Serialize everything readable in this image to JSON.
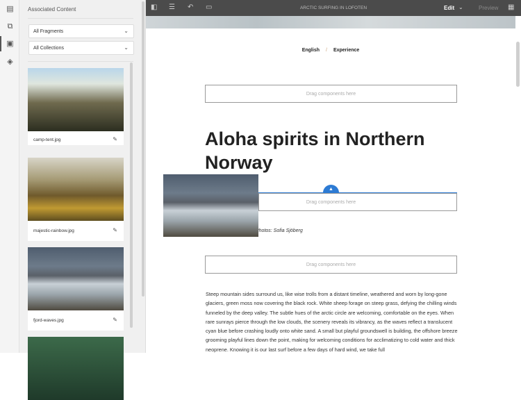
{
  "sidebar": {
    "title": "Associated Content",
    "fragments_select": "All Fragments",
    "collections_select": "All Collections",
    "assets": [
      {
        "name": "camp-tent.jpg"
      },
      {
        "name": "majestic-rainbow.jpg"
      },
      {
        "name": "fjord-waves.jpg"
      },
      {
        "name": ""
      }
    ]
  },
  "toolbar": {
    "title": "ARCTIC SURFING IN LOFOTEN",
    "mode": "Edit",
    "preview": "Preview"
  },
  "page": {
    "breadcrumb": [
      "English",
      "Experience"
    ],
    "breadcrumb_sep": "/",
    "drop_text": "Drag components here",
    "heading": "Aloha spirits in Northern Norway",
    "photo_credit": "Photos: Sofia Sjöberg",
    "body": "Steep mountain sides surround us, like wise trolls from a distant timeline, weathered and worn by long-gone glaciers, green moss now covering the black rock. White sheep forage on steep grass, defying the chilling winds funneled by the deep valley. The subtle hues of the arctic circle are welcoming, comfortable on the eyes. When rare sunrays pierce through the low clouds, the scenery reveals its vibrancy, as the waves reflect a translucent cyan blue before crashing loudly onto white sand. A small but playful groundswell is building, the offshore breeze grooming playful lines down the point, making for welcoming conditions for acclimatizing to cold water and thick neoprene. Knowing it is our last surf before a few days of hard wind, we take full"
  },
  "colors": {
    "accent": "#2d7bd4",
    "toolbar": "#4b4b4b"
  }
}
